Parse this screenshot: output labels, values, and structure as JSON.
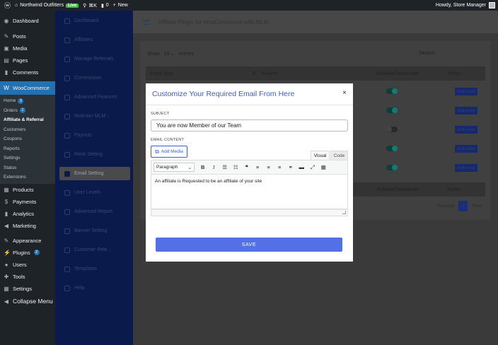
{
  "adminbar": {
    "site_name": "Northwind Outfitters",
    "live_badge": "Live",
    "shortcut": "⌘K",
    "comments_count": "0",
    "new_label": "New",
    "greeting": "Howdy, Store Manager"
  },
  "sidebar": {
    "items_top": [
      {
        "label": "Dashboard",
        "icon": "dashboard-icon",
        "glyph": "◉"
      },
      {
        "label": "Posts",
        "icon": "pin-icon",
        "glyph": "✎"
      },
      {
        "label": "Media",
        "icon": "media-icon",
        "glyph": "▣"
      },
      {
        "label": "Pages",
        "icon": "pages-icon",
        "glyph": "▤"
      },
      {
        "label": "Comments",
        "icon": "comments-icon",
        "glyph": "▮"
      }
    ],
    "woocommerce": {
      "label": "WooCommerce",
      "glyph": "W"
    },
    "woo_sub": [
      {
        "label": "Home",
        "badge": "3"
      },
      {
        "label": "Orders",
        "badge": "1"
      },
      {
        "label": "Affiliate & Referral",
        "badge": ""
      },
      {
        "label": "Customers",
        "badge": ""
      },
      {
        "label": "Coupons",
        "badge": ""
      },
      {
        "label": "Reports",
        "badge": ""
      },
      {
        "label": "Settings",
        "badge": ""
      },
      {
        "label": "Status",
        "badge": ""
      },
      {
        "label": "Extensions",
        "badge": ""
      }
    ],
    "items_mid": [
      {
        "label": "Products",
        "icon": "products-icon",
        "glyph": "▦"
      },
      {
        "label": "Payments",
        "icon": "payments-icon",
        "glyph": "$"
      },
      {
        "label": "Analytics",
        "icon": "analytics-icon",
        "glyph": "▮"
      },
      {
        "label": "Marketing",
        "icon": "marketing-icon",
        "glyph": "◀"
      }
    ],
    "items_bottom": [
      {
        "label": "Appearance",
        "icon": "appearance-icon",
        "glyph": "✎",
        "badge": ""
      },
      {
        "label": "Plugins",
        "icon": "plugins-icon",
        "glyph": "⚡",
        "badge": "2"
      },
      {
        "label": "Users",
        "icon": "users-icon",
        "glyph": "●",
        "badge": ""
      },
      {
        "label": "Tools",
        "icon": "tools-icon",
        "glyph": "✚",
        "badge": ""
      },
      {
        "label": "Settings",
        "icon": "settings-icon",
        "glyph": "▦",
        "badge": ""
      },
      {
        "label": "Collapse Menu",
        "icon": "collapse-icon",
        "glyph": "◀",
        "badge": ""
      }
    ]
  },
  "plugin_nav": {
    "items": [
      {
        "label": "Dashboard"
      },
      {
        "label": "Affiliates"
      },
      {
        "label": "Manage Referrals"
      },
      {
        "label": "Commission"
      },
      {
        "label": "Advanced Features"
      },
      {
        "label": "Multi-tier MLM ↓"
      },
      {
        "label": "Payouts"
      },
      {
        "label": "Rank Setting"
      },
      {
        "label": "Email Setting"
      },
      {
        "label": "User Levels"
      },
      {
        "label": "Advanced Report"
      },
      {
        "label": "Banner Setting"
      },
      {
        "label": "Customer Rele..."
      },
      {
        "label": "Templates"
      },
      {
        "label": "Help"
      }
    ],
    "selected_index": 8
  },
  "topbar": {
    "title": "Affiliate Plugin for WooCommerce with MLM"
  },
  "table": {
    "show_label": "Show",
    "show_value": "10",
    "entries_label": "entries",
    "search_label": "Search:",
    "columns": [
      "Email type",
      "Subject",
      "Activate/Deactivate",
      "Action"
    ],
    "rows": [
      {
        "active": true,
        "action": "Edit email"
      },
      {
        "active": true,
        "action": "Edit email"
      },
      {
        "active": false,
        "action": "Edit email"
      },
      {
        "active": true,
        "action": "Edit email"
      },
      {
        "active": true,
        "action": "Edit email"
      }
    ],
    "footer_cols": [
      "Activate/Deactivate",
      "Action"
    ],
    "pagination": {
      "previous": "Previous",
      "page": "1",
      "next": "Next"
    }
  },
  "modal": {
    "title": "Customize Your Required Email From Here",
    "close": "×",
    "subject_label": "SUBJECT",
    "subject_value": "You are now Member of our Team",
    "content_label": "EMAIL CONTENT",
    "add_media": "Add Media",
    "tab_visual": "Visual",
    "tab_code": "Code",
    "format_value": "Paragraph",
    "body_text": "An affiliate is Requested to be an affiliate of your site",
    "save_label": "SAVE"
  },
  "colors": {
    "accent": "#3b5bdb",
    "save": "#5470e6",
    "wp_blue": "#2271b1"
  }
}
